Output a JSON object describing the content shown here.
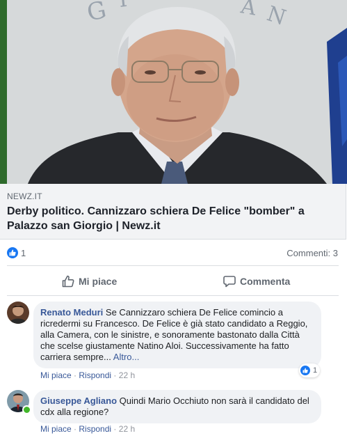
{
  "link_preview": {
    "domain": "NEWZ.IT",
    "title": "Derby politico. Cannizzaro schiera De Felice \"bomber\" a Palazzo san Giorgio | Newz.it"
  },
  "stats": {
    "likes": "1",
    "comments": "Commenti: 3"
  },
  "actions": {
    "like": "Mi piace",
    "comment": "Commenta"
  },
  "comments": [
    {
      "author": "Renato Meduri",
      "text": "Se Cannizzaro schiera De Felice comincio a ricredermi su Francesco. De Felice è già stato candidato a Reggio, alla Camera, con le sinistre, e sonoramente bastonato dalla Città che scelse giustamente Natino Aloi. Successivamente ha fatto carriera sempre...",
      "more": "Altro...",
      "like": "Mi piace",
      "sep": "·",
      "reply": "Rispondi",
      "time": "22 h",
      "reactions": "1"
    },
    {
      "author": "Giuseppe Agliano",
      "text": "Quindi Mario Occhiuto non sarà il candidato del cdx alla regione?",
      "like": "Mi piace",
      "sep": "·",
      "reply": "Rispondi",
      "time": "22 h"
    }
  ],
  "icons": {
    "like_badge": "thumbs-up-icon",
    "like_action": "thumbs-up-outline-icon",
    "comment_action": "speech-bubble-icon"
  },
  "colors": {
    "accent": "#1877f2",
    "link": "#385898",
    "online": "#42b72a"
  }
}
